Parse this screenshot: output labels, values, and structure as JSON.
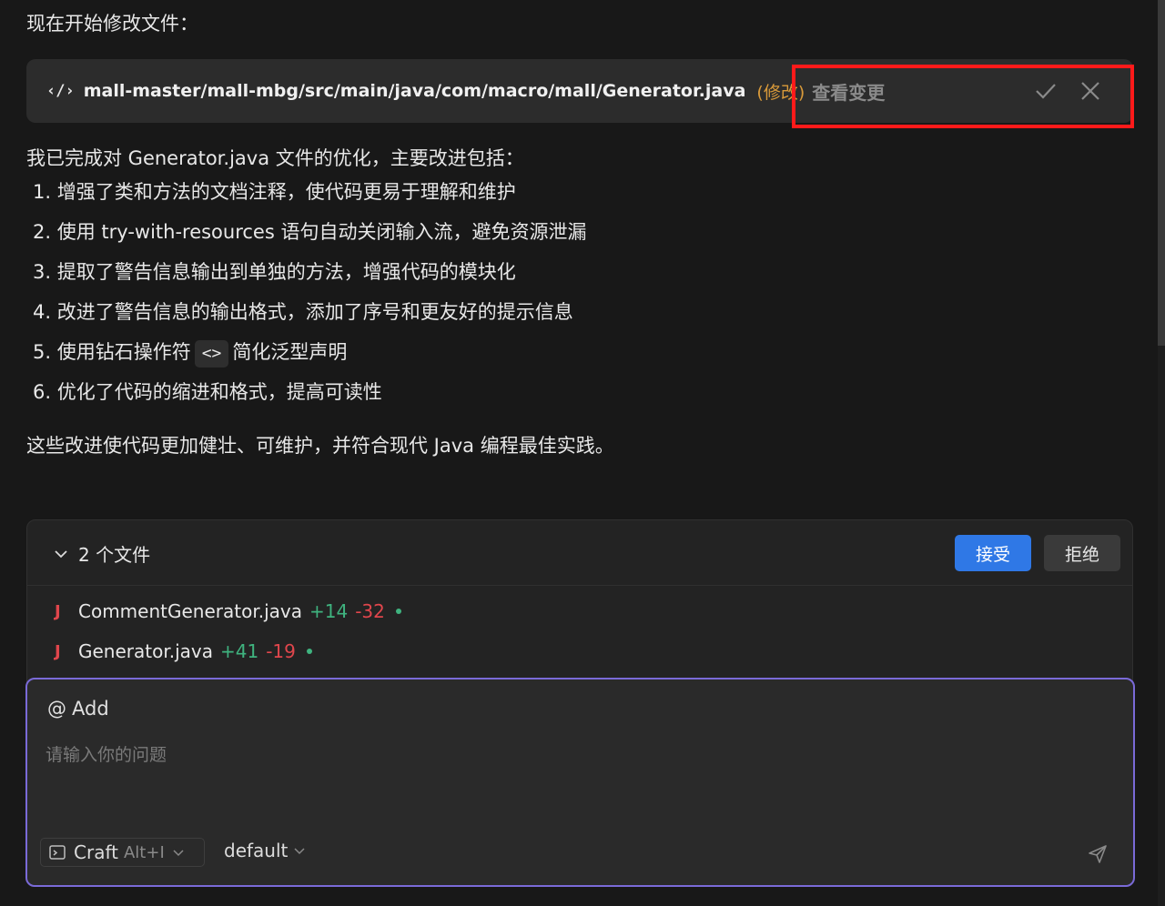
{
  "intro_text": "现在开始修改文件：",
  "edited_file": {
    "icon": "code-icon",
    "icon_glyph": "‹/›",
    "path": "mall-master/mall-mbg/src/main/java/com/macro/mall/Generator.java",
    "tag": "(修改)",
    "view_changes_label": "查看变更"
  },
  "summary_text": "我已完成对 Generator.java 文件的优化，主要改进包括：",
  "improvements": [
    {
      "text": "1. 增强了类和方法的文档注释，使代码更易于理解和维护"
    },
    {
      "text": "2. 使用 try-with-resources 语句自动关闭输入流，避免资源泄漏"
    },
    {
      "text": "3. 提取了警告信息输出到单独的方法，增强代码的模块化"
    },
    {
      "text": "4. 改进了警告信息的输出格式，添加了序号和更友好的提示信息"
    },
    {
      "before": "5. 使用钻石操作符",
      "code": "<>",
      "after": "简化泛型声明"
    },
    {
      "text": "6. 优化了代码的缩进和格式，提高可读性"
    }
  ],
  "conclusion_text": "这些改进使代码更加健壮、可维护，并符合现代 Java 编程最佳实践。",
  "files_panel": {
    "title": "2 个文件",
    "accept_label": "接受",
    "reject_label": "拒绝",
    "files": [
      {
        "icon": "J",
        "name": "CommentGenerator.java",
        "additions": "+14",
        "deletions": "-32"
      },
      {
        "icon": "J",
        "name": "Generator.java",
        "additions": "+41",
        "deletions": "-19"
      }
    ]
  },
  "input": {
    "mention_at": "@",
    "mention_label": "Add",
    "placeholder": "请输入你的问题",
    "mode_name": "Craft",
    "mode_shortcut": "Alt+I",
    "model_name": "default"
  },
  "colors": {
    "accent_blue": "#2f78e6",
    "additions_green": "#3fb37f",
    "deletions_red": "#e0464c",
    "modify_orange": "#d99a3a",
    "highlight_red": "#ff1a1a"
  }
}
